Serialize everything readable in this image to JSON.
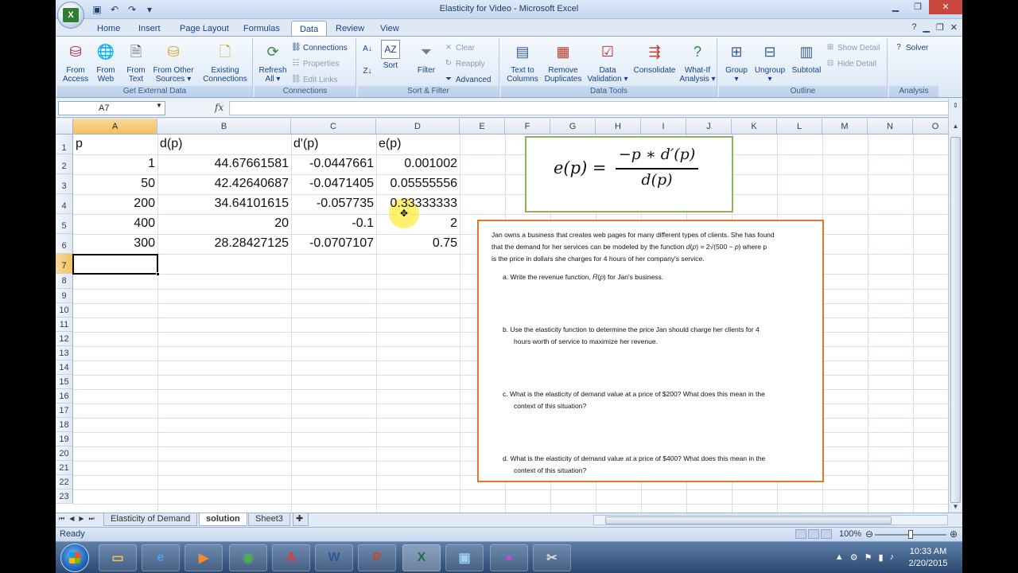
{
  "app": {
    "title": "Elasticity for Video - Microsoft Excel"
  },
  "ribbon_tabs": [
    "Home",
    "Insert",
    "Page Layout",
    "Formulas",
    "Data",
    "Review",
    "View"
  ],
  "ribbon": {
    "get_external_data": {
      "label": "Get External Data",
      "buttons": [
        {
          "line1": "From",
          "line2": "Access"
        },
        {
          "line1": "From",
          "line2": "Web"
        },
        {
          "line1": "From",
          "line2": "Text"
        },
        {
          "line1": "From Other",
          "line2": "Sources ▾"
        },
        {
          "line1": "Existing",
          "line2": "Connections"
        }
      ]
    },
    "connections": {
      "label": "Connections",
      "refresh": {
        "line1": "Refresh",
        "line2": "All ▾"
      },
      "small": [
        "Connections",
        "Properties",
        "Edit Links"
      ]
    },
    "sort_filter": {
      "label": "Sort & Filter",
      "sort": "Sort",
      "filter": "Filter",
      "small": [
        "Clear",
        "Reapply",
        "Advanced"
      ]
    },
    "data_tools": {
      "label": "Data Tools",
      "buttons": [
        {
          "line1": "Text to",
          "line2": "Columns"
        },
        {
          "line1": "Remove",
          "line2": "Duplicates"
        },
        {
          "line1": "Data",
          "line2": "Validation ▾"
        },
        {
          "line1": "Consolidate",
          "line2": ""
        },
        {
          "line1": "What-If",
          "line2": "Analysis ▾"
        }
      ]
    },
    "outline": {
      "label": "Outline",
      "buttons": [
        {
          "line1": "Group",
          "line2": "▾"
        },
        {
          "line1": "Ungroup",
          "line2": "▾"
        },
        {
          "line1": "Subtotal",
          "line2": ""
        }
      ],
      "small": [
        "Show Detail",
        "Hide Detail"
      ]
    },
    "analysis": {
      "label": "Analysis",
      "solver": "Solver"
    }
  },
  "formula_bar": {
    "name_box": "A7",
    "fx": "fx",
    "value": ""
  },
  "columns": [
    "A",
    "B",
    "C",
    "D",
    "E",
    "F",
    "G",
    "H",
    "I",
    "J",
    "K",
    "L",
    "M",
    "N",
    "O"
  ],
  "rows": [
    "1",
    "2",
    "3",
    "4",
    "5",
    "6",
    "7",
    "8",
    "9",
    "10",
    "11",
    "12",
    "13",
    "14",
    "15",
    "16",
    "17",
    "18",
    "19",
    "20",
    "21",
    "22",
    "23"
  ],
  "sheet": {
    "headers": [
      "p",
      "d(p)",
      "d'(p)",
      "e(p)"
    ],
    "data": [
      [
        "1",
        "44.67661581",
        "-0.0447661",
        "0.001002"
      ],
      [
        "50",
        "42.42640687",
        "-0.0471405",
        "0.05555556"
      ],
      [
        "200",
        "34.64101615",
        "-0.057735",
        "0.33333333"
      ],
      [
        "400",
        "20",
        "-0.1",
        "2"
      ],
      [
        "300",
        "28.28427125",
        "-0.0707107",
        "0.75"
      ]
    ]
  },
  "formula_image": {
    "lhs": "e(p) =",
    "numerator": "−p ∗ d′(p)",
    "denominator": "d(p)"
  },
  "problem": {
    "intro_1": "Jan owns a business that creates web pages for many different types of clients.  She has found",
    "intro_2": "that the demand for her services can be modeled by the function 𝑑(𝑝) = 2√(500 − 𝑝)  where p",
    "intro_3": "is the price in dollars she charges for 4 hours of her company's service.",
    "a": "a.   Write the revenue function, 𝑅(𝑝) for Jan's business.",
    "b_1": "b.   Use the elasticity function to determine the price Jan should charge her clients for 4",
    "b_2": "hours worth of service to maximize her revenue.",
    "c_1": "c.   What is the elasticity of demand value at a price of $200?  What does this mean in the",
    "c_2": "context of this situation?",
    "d_1": "d.   What is the elasticity of demand value at a price of $400?  What does this mean in the",
    "d_2": "context of this situation?"
  },
  "sheet_tabs": [
    "Elasticity of Demand",
    "solution",
    "Sheet3"
  ],
  "active_sheet": "solution",
  "status": {
    "text": "Ready",
    "zoom": "100%"
  },
  "taskbar": {
    "time": "10:33 AM",
    "date": "2/20/2015"
  },
  "colors": {
    "selected_header": "#f1c15f",
    "formula_border": "#8cb45a",
    "problem_border": "#e0752e",
    "highlight": "#ffeb3c"
  }
}
